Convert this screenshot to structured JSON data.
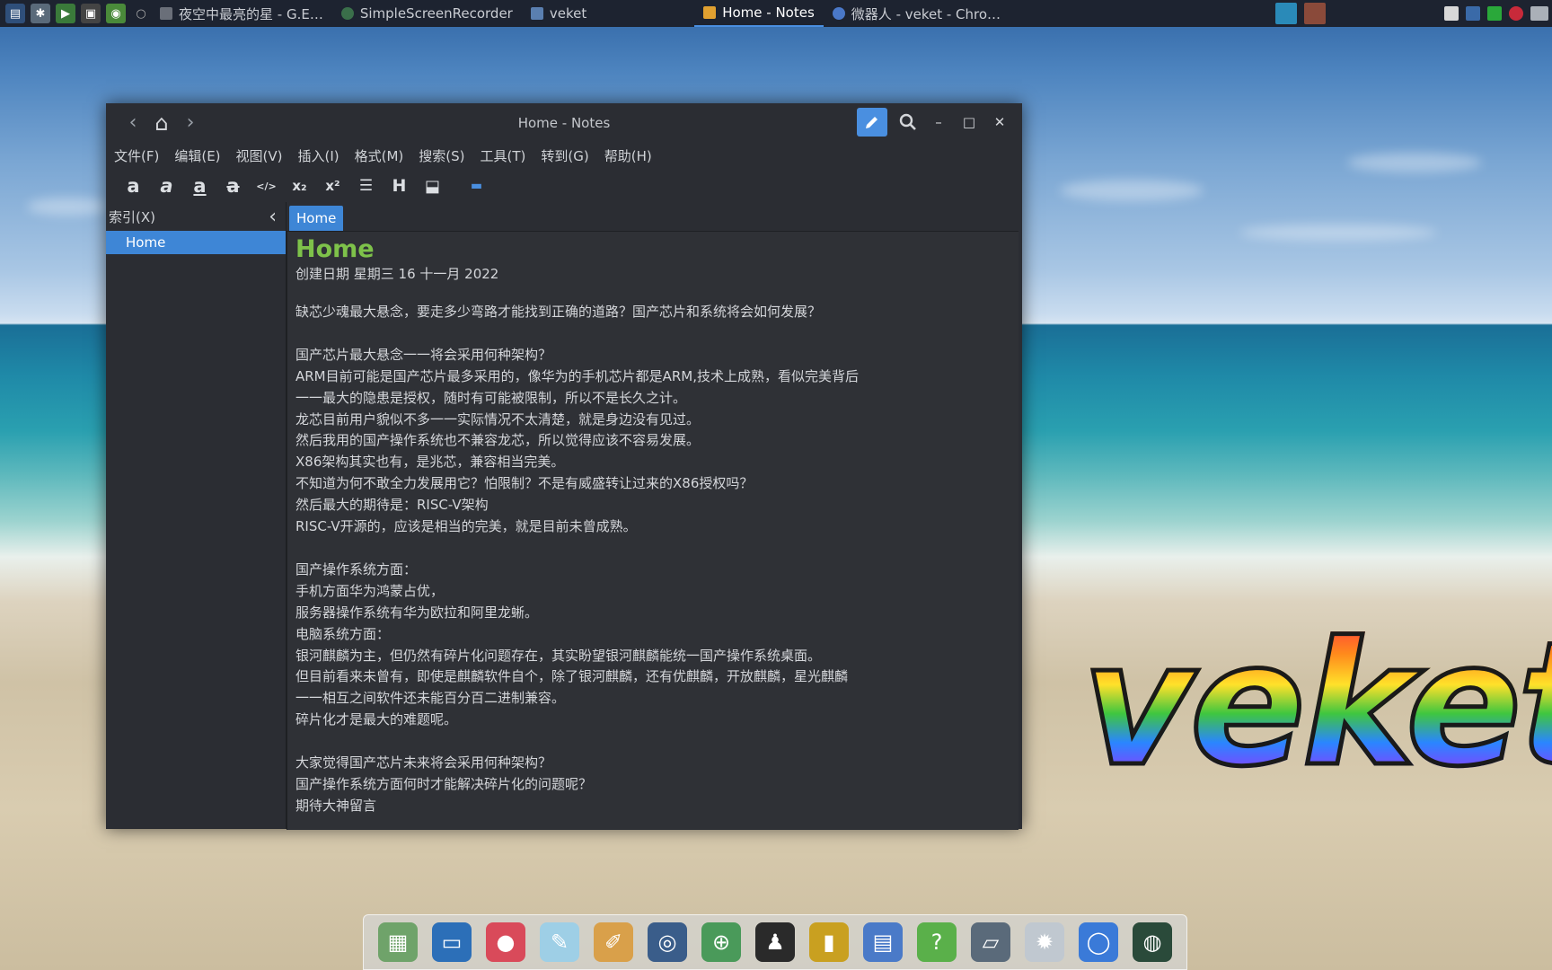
{
  "taskbar": {
    "tasks": [
      {
        "label": "夜空中最亮的星 - G.E…",
        "color": "#8a8f99"
      },
      {
        "label": "SimpleScreenRecorder",
        "color": "#3a6f4a"
      },
      {
        "label": "veket",
        "color": "#5a7fb0"
      },
      {
        "label": "Home - Notes",
        "color": "#e0a030"
      },
      {
        "label": "微器人 - veket - Chro…",
        "color": "#4a78c8"
      }
    ]
  },
  "window": {
    "title": "Home - Notes",
    "nav": {
      "back": "‹",
      "home": "⌂",
      "forward": "›"
    },
    "controls": {
      "minimize": "–",
      "maximize": "□",
      "close": "✕"
    },
    "menu": [
      "文件(F)",
      "编辑(E)",
      "视图(V)",
      "插入(I)",
      "格式(M)",
      "搜索(S)",
      "工具(T)",
      "转到(G)",
      "帮助(H)"
    ],
    "toolbar": [
      {
        "name": "bold-icon",
        "glyph": "a"
      },
      {
        "name": "italic-icon",
        "glyph": "a"
      },
      {
        "name": "underline-icon",
        "glyph": "a"
      },
      {
        "name": "strikethrough-icon",
        "glyph": "a"
      },
      {
        "name": "code-icon",
        "glyph": "</>"
      },
      {
        "name": "subscript-icon",
        "glyph": "x₂"
      },
      {
        "name": "superscript-icon",
        "glyph": "x²"
      },
      {
        "name": "bullet-list-icon",
        "glyph": "☰"
      },
      {
        "name": "heading-icon",
        "glyph": "H"
      },
      {
        "name": "insert-image-icon",
        "glyph": "⬓"
      },
      {
        "name": "folder-icon",
        "glyph": "▬"
      }
    ],
    "sidebar": {
      "header": "索引(X)",
      "collapse": "‹",
      "items": [
        "Home"
      ]
    },
    "tab": "Home",
    "note": {
      "title": "Home",
      "date": "创建日期 星期三 16 十一月 2022",
      "body": "缺芯少魂最大悬念，要走多少弯路才能找到正确的道路？国产芯片和系统将会如何发展？\n\n国产芯片最大悬念一一将会采用何种架构？\nARM目前可能是国产芯片最多采用的，像华为的手机芯片都是ARM,技术上成熟，看似完美背后\n一一最大的隐患是授权，随时有可能被限制，所以不是长久之计。\n龙芯目前用户貌似不多一一实际情况不太清楚，就是身边没有见过。\n然后我用的国产操作系统也不兼容龙芯，所以觉得应该不容易发展。\nX86架构其实也有，是兆芯，兼容相当完美。\n不知道为何不敢全力发展用它？怕限制？不是有威盛转让过来的X86授权吗？\n然后最大的期待是：RISC-V架构\nRISC-V开源的，应该是相当的完美，就是目前未曾成熟。\n\n国产操作系统方面：\n手机方面华为鸿蒙占优，\n服务器操作系统有华为欧拉和阿里龙蜥。\n电脑系统方面：\n银河麒麟为主，但仍然有碎片化问题存在，其实盼望银河麒麟能统一国产操作系统桌面。\n但目前看来未曾有，即使是麒麟软件自个，除了银河麒麟，还有优麒麟，开放麒麟，星光麒麟\n一一相互之间软件还未能百分百二进制兼容。\n碎片化才是最大的难题呢。\n\n大家觉得国产芯片未来将会采用何种架构？\n国产操作系统方面何时才能解决碎片化的问题呢？\n期待大神留言"
    }
  },
  "logo": {
    "text": "veket"
  },
  "dock": [
    {
      "name": "file-manager-icon",
      "color": "#6fa36a"
    },
    {
      "name": "monitor-icon",
      "color": "#2c6fb8"
    },
    {
      "name": "pig-app-icon",
      "color": "#d94a5a"
    },
    {
      "name": "text-editor-icon",
      "color": "#9ecfe6"
    },
    {
      "name": "paint-icon",
      "color": "#d9a04a"
    },
    {
      "name": "media-player-icon",
      "color": "#3a5d8a"
    },
    {
      "name": "network-icon",
      "color": "#4a9a5a"
    },
    {
      "name": "qq-penguin-icon",
      "color": "#2a2a2a"
    },
    {
      "name": "notebook-icon",
      "color": "#c9a020"
    },
    {
      "name": "spreadsheet-icon",
      "color": "#4a7ac8"
    },
    {
      "name": "help-icon",
      "color": "#5ab04a"
    },
    {
      "name": "scanner-icon",
      "color": "#5a6a7a"
    },
    {
      "name": "settings-gear-icon",
      "color": "#c0c8d0"
    },
    {
      "name": "chrome-icon",
      "color": "#3a7ad8"
    },
    {
      "name": "globe-icon",
      "color": "#2a4a3a"
    }
  ]
}
